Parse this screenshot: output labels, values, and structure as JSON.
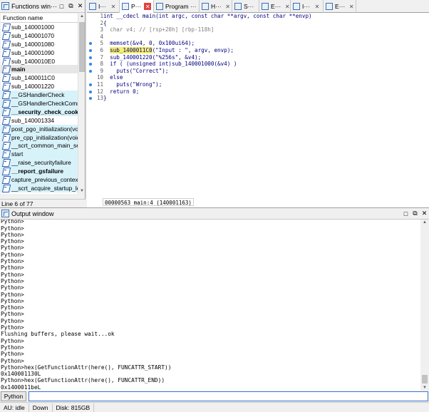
{
  "functions_window": {
    "title": "Functions win···",
    "column_header": "Function name",
    "status": "Line 6 of 77",
    "items": [
      {
        "name": "sub_140001000",
        "style": ""
      },
      {
        "name": "sub_140001070",
        "style": ""
      },
      {
        "name": "sub_140001080",
        "style": ""
      },
      {
        "name": "sub_140001090",
        "style": ""
      },
      {
        "name": "sub_1400010E0",
        "style": ""
      },
      {
        "name": "main",
        "style": "sel bold"
      },
      {
        "name": "sub_1400011C0",
        "style": ""
      },
      {
        "name": "sub_140001220",
        "style": ""
      },
      {
        "name": "__GSHandlerCheck",
        "style": "lib"
      },
      {
        "name": "__GSHandlerCheckCommo",
        "style": "lib"
      },
      {
        "name": "__security_check_cookie",
        "style": "lib bold"
      },
      {
        "name": "sub_140001334",
        "style": ""
      },
      {
        "name": "post_pgo_initialization(voic",
        "style": "lib"
      },
      {
        "name": "pre_cpp_initialization(void)",
        "style": "lib"
      },
      {
        "name": "__scrt_common_main_seh(",
        "style": "lib"
      },
      {
        "name": "start",
        "style": "lib"
      },
      {
        "name": "__raise_securityfailure",
        "style": "lib"
      },
      {
        "name": "__report_gsfailure",
        "style": "lib bold"
      },
      {
        "name": "capture_previous_context",
        "style": "lib"
      },
      {
        "name": "__scrt_acquire_startup_lock",
        "style": "lib"
      }
    ]
  },
  "tabs": [
    {
      "label": "I···",
      "close": "✕",
      "active": false
    },
    {
      "label": "P···",
      "close": "✕",
      "active": true
    },
    {
      "label": "Program ···",
      "close": "✕",
      "active": false
    },
    {
      "label": "H···",
      "close": "✕",
      "active": false
    },
    {
      "label": "S···",
      "close": "✕",
      "active": false
    },
    {
      "label": "E···",
      "close": "✕",
      "active": false
    },
    {
      "label": "I···",
      "close": "✕",
      "active": false
    },
    {
      "label": "E···",
      "close": "✕",
      "active": false
    }
  ],
  "pseudocode": {
    "lines": [
      {
        "num": "1",
        "dot": false,
        "text": "int __cdecl main(int argc, const char **argv, const char **envp)",
        "cls": ""
      },
      {
        "num": "2",
        "dot": false,
        "text": "{",
        "cls": ""
      },
      {
        "num": "3",
        "dot": false,
        "text": "  char v4; // [rsp+20h] [rbp-118h]",
        "cls": "c-cm"
      },
      {
        "num": "4",
        "dot": false,
        "text": "",
        "cls": ""
      },
      {
        "num": "5",
        "dot": true,
        "text": "  memset(&v4, 0, 0x100ui64);",
        "cls": ""
      },
      {
        "num": "6",
        "dot": true,
        "text": "  sub_1400011C0(\"Input : \", argv, envp);",
        "cls": "hlcall"
      },
      {
        "num": "7",
        "dot": true,
        "text": "  sub_140001220(\"%256s\", &v4);",
        "cls": ""
      },
      {
        "num": "8",
        "dot": true,
        "text": "  if ( (unsigned int)sub_140001000(&v4) )",
        "cls": ""
      },
      {
        "num": "9",
        "dot": true,
        "text": "    puts(\"Correct\");",
        "cls": ""
      },
      {
        "num": "10",
        "dot": false,
        "text": "  else",
        "cls": ""
      },
      {
        "num": "11",
        "dot": true,
        "text": "    puts(\"Wrong\");",
        "cls": ""
      },
      {
        "num": "12",
        "dot": true,
        "text": "  return 0;",
        "cls": ""
      },
      {
        "num": "13",
        "dot": true,
        "text": "}",
        "cls": ""
      }
    ],
    "status": "00000563 main:4 (140001163)"
  },
  "output_window": {
    "title": "Output window",
    "lines": [
      "Python>",
      "Python>",
      "Python>",
      "Python>",
      "Python>",
      "Python>",
      "Python>",
      "Python>",
      "Python>",
      "Python>",
      "Python>",
      "Python>",
      "Python>",
      "Python>",
      "Python>",
      "Python>",
      "Python>",
      "Flushing buffers, please wait...ok",
      "Python>",
      "Python>",
      "Python>",
      "Python>",
      "Python>hex(GetFunctionAttr(here(), FUNCATTR_START))",
      "0x140001130L",
      "Python>hex(GetFunctionAttr(here(), FUNCATTR_END))",
      "0x1400011beL"
    ]
  },
  "command_line": {
    "language": "Python",
    "value": ""
  },
  "statusbar": {
    "mode": "AU:  idle",
    "direction": "Down",
    "disk": "Disk: 815GB"
  }
}
